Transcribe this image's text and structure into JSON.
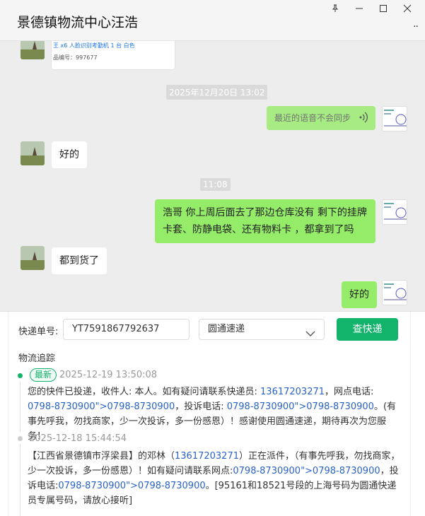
{
  "window": {
    "title": "景德镇物流中心汪浩",
    "more": "··"
  },
  "chat": {
    "card": {
      "line1": "王 x6 人脸识别考勤机 1 台 白色",
      "line2": "品编号：997677"
    },
    "timestamps": [
      "2025年12月20日 13:02",
      "11:08"
    ],
    "messages": [
      {
        "from": "me",
        "text": "最近的语音不会同步"
      },
      {
        "from": "them",
        "text": "好的"
      },
      {
        "from": "me",
        "text": "浩哥  你上周后面去了那边仓库没有 剩下的挂牌卡套、防静电袋、还有物料卡 ，都拿到了吗"
      },
      {
        "from": "them",
        "text": "都到货了"
      },
      {
        "from": "me",
        "text": "好的"
      }
    ]
  },
  "lookup": {
    "tracking_label": "快递单号:",
    "tracking_value": "YT7591867792637",
    "carrier_value": "圆通速递",
    "query_button": "查快递",
    "section_title": "物流追踪",
    "latest_badge": "最新",
    "events": [
      {
        "time": "2025-12-19 13:50:08",
        "parts": [
          {
            "t": "您的快件已投递，收件人: 本人。如有疑问请联系快递员: "
          },
          {
            "t": "13617203271",
            "link": true
          },
          {
            "t": "，网点电话: "
          },
          {
            "t": "0798-8730900\">0798-8730900",
            "link": true
          },
          {
            "t": "，投诉电话: "
          },
          {
            "t": "0798-8730900\">0798-8730900",
            "link": true
          },
          {
            "t": "。(有事先呼我，勿找商家，少一次投诉，多一份感恩）！感谢使用圆通速递，期待再次为您服务！"
          }
        ]
      },
      {
        "time": "2025-12-18 15:44:54",
        "parts": [
          {
            "t": "【江西省景德镇市浮梁县】的邓林（"
          },
          {
            "t": "13617203271",
            "link": true
          },
          {
            "t": "）正在派件，（有事先呼我，勿找商家，少一次投诉，多一份感恩）！如有疑问请联系网点:"
          },
          {
            "t": "0798-8730900\">0798-8730900",
            "link": true
          },
          {
            "t": "，投诉电话:"
          },
          {
            "t": "0798-8730900\">0798-8730900",
            "link": true
          },
          {
            "t": "。[95161和18521号段的上海号码为圆通快递员专属号码，请放心接听]"
          }
        ]
      }
    ]
  },
  "colors": {
    "accent_green": "#12b36b",
    "bubble_green": "#95ec69",
    "link_blue": "#2962c9"
  }
}
